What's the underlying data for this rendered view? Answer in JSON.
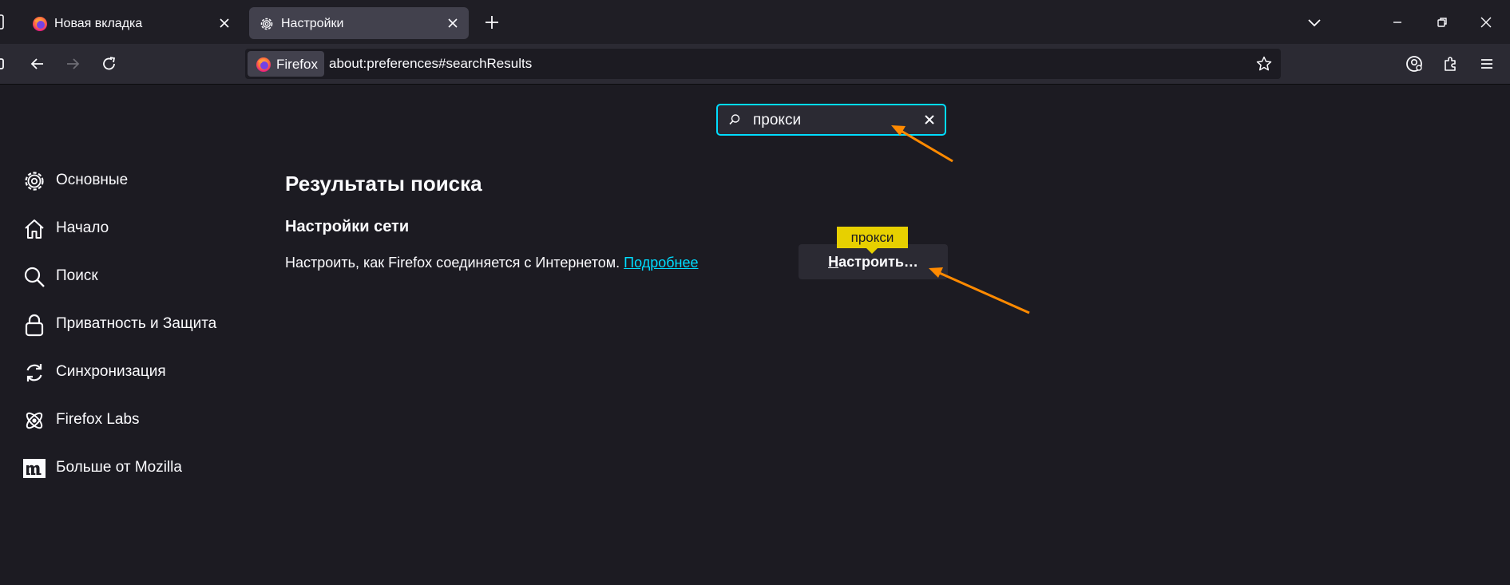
{
  "tabs": [
    {
      "title": "Новая вкладка",
      "active": false,
      "icon": "firefox-icon"
    },
    {
      "title": "Настройки",
      "active": true,
      "icon": "gear-icon"
    }
  ],
  "urlbar": {
    "identity_label": "Firefox",
    "url": "about:preferences#searchResults"
  },
  "search": {
    "value": "прокси"
  },
  "sidebar": {
    "items": [
      {
        "label": "Основные",
        "icon": "gear-icon"
      },
      {
        "label": "Начало",
        "icon": "home-icon"
      },
      {
        "label": "Поиск",
        "icon": "search-icon"
      },
      {
        "label": "Приватность и Защита",
        "icon": "lock-icon"
      },
      {
        "label": "Синхронизация",
        "icon": "sync-icon"
      },
      {
        "label": "Firefox Labs",
        "icon": "atom-icon"
      },
      {
        "label": "Больше от Mozilla",
        "icon": "mozilla-logo-icon"
      }
    ]
  },
  "main": {
    "title": "Результаты поиска",
    "group_title": "Настройки сети",
    "description": "Настроить, как Firefox соединяется с Интернетом.",
    "learn_more": "Подробнее",
    "button_accesskey": "Н",
    "button_rest": "астроить…",
    "tooltip": "прокси"
  },
  "colors": {
    "background": "#1c1b22",
    "accent": "#00ddff",
    "highlight": "#e7d000",
    "annotation_arrow": "#ff8a00"
  }
}
